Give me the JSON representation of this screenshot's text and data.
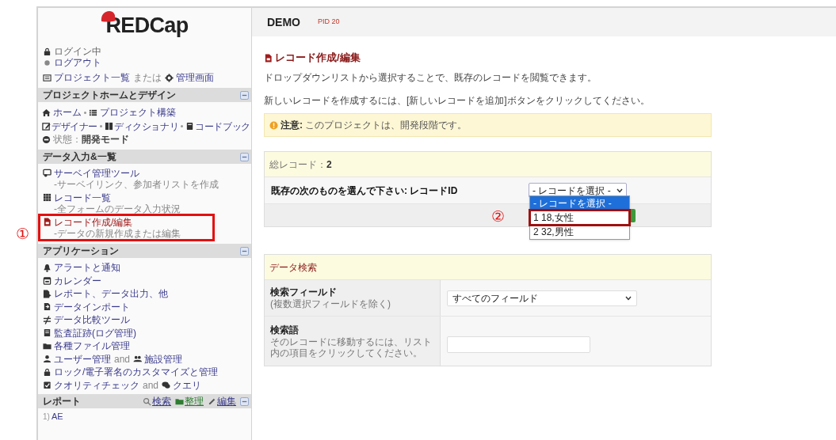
{
  "sidebar": {
    "logo": "REDCap",
    "login": "ログイン中",
    "logout": "ログアウト",
    "project_links": {
      "list": "プロジェクト一覧",
      "joiner": "または",
      "admin": "管理画面"
    },
    "design": {
      "title": "プロジェクトホームとデザイン",
      "line_1": [
        "ホーム",
        "プロジェクト構築"
      ],
      "line_2": [
        "デザイナー",
        "ディクショナリ",
        "コードブック"
      ],
      "status_label": "状態：",
      "status_value": "開発モード"
    },
    "data_entry": {
      "title": "データ入力&一覧",
      "items": [
        {
          "label": "サーベイ管理ツール",
          "note": "-サーベイリンク、参加者リストを作成",
          "selected": false
        },
        {
          "label": "レコード一覧",
          "note": "-全フォームのデータ入力状況",
          "selected": false
        },
        {
          "label": "レコード作成/編集",
          "note": "-データの新規作成または編集",
          "selected": true
        }
      ]
    },
    "applications": {
      "title": "アプリケーション",
      "items": [
        {
          "label": "アラートと通知"
        },
        {
          "label": "カレンダー"
        },
        {
          "label": "レポート、データ出力、他"
        },
        {
          "label": "データインポート"
        },
        {
          "label": "データ比較ツール"
        },
        {
          "label": "監査証跡(ログ管理)"
        },
        {
          "label": "各種ファイル管理"
        },
        {
          "label": "ユーザー管理",
          "joiner": "and",
          "second": "施設管理"
        },
        {
          "label": "ロック/電子署名のカスタマイズと管理"
        },
        {
          "label": "クオリティチェック",
          "joiner": "and",
          "second": "クエリ"
        }
      ]
    },
    "reports": {
      "title": "レポート",
      "actions": [
        "検索",
        "整理",
        "編集"
      ],
      "items": [
        {
          "number": "1)",
          "label": "AE"
        }
      ]
    }
  },
  "main": {
    "project": "DEMO",
    "pid": "PID 20",
    "title": "レコード作成/編集",
    "intro": [
      "ドロップダウンリストから選択することで、既存のレコードを閲覧できます。",
      "新しいレコードを作成するには、[新しいレコードを追加]ボタンをクリックしてください。"
    ],
    "notice": "**注意:** このプロジェクトは、開発段階です。",
    "records": {
      "total": "総レコード：**2**",
      "label": "既存の次のものを選んで下さい: レコードID",
      "select_value": "- レコードを選択 -",
      "options": [
        {
          "label": "- レコードを選択 -",
          "selected": true
        },
        {
          "label": "1 18,女性",
          "selected": false
        },
        {
          "label": "2 32,男性",
          "selected": false
        }
      ]
    },
    "search": {
      "title": "データ検索",
      "field_label": "検索フィールド",
      "field_note": "(複数選択フィールドを除く)",
      "field_value": "すべてのフィールド",
      "term_label": "検索語",
      "term_note": "そのレコードに移動するには、リスト内の項目をクリックしてください。"
    }
  },
  "annotations": {
    "markers": [
      "①",
      "②"
    ]
  }
}
